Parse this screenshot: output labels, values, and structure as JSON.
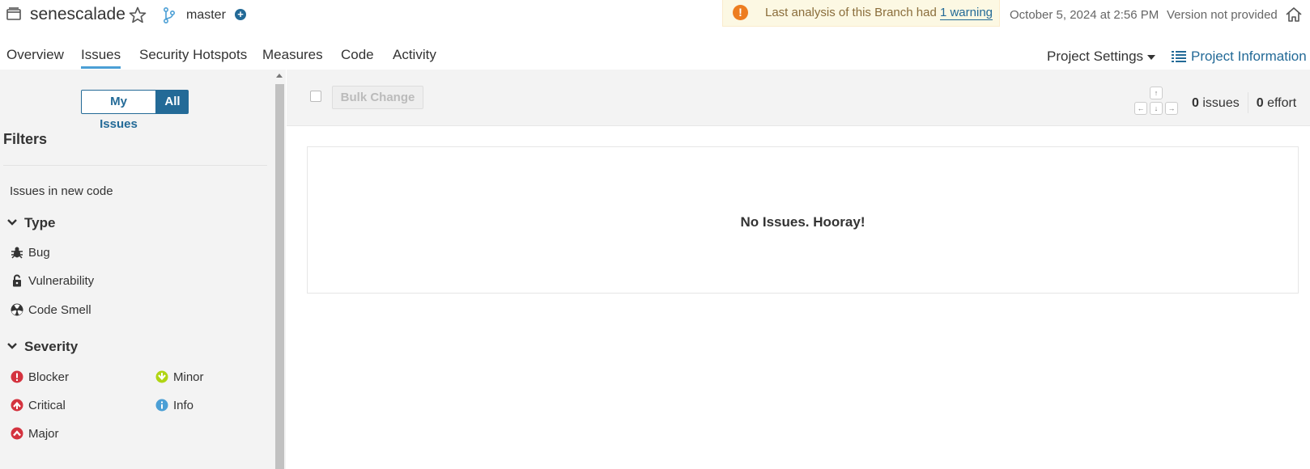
{
  "header": {
    "project_name": "senescalade",
    "branch": "master",
    "warning_text": "Last analysis of this Branch had",
    "warning_link": "1 warning",
    "analysis_date": "October 5, 2024 at 2:56 PM",
    "version": "Version not provided"
  },
  "nav": {
    "tabs": [
      "Overview",
      "Issues",
      "Security Hotspots",
      "Measures",
      "Code",
      "Activity"
    ],
    "active_tab": "Issues",
    "project_settings": "Project Settings",
    "project_information": "Project Information"
  },
  "sidebar": {
    "my_issues": "My Issues",
    "all": "All",
    "filters_title": "Filters",
    "new_code": "Issues in new code",
    "type_title": "Type",
    "types": [
      "Bug",
      "Vulnerability",
      "Code Smell"
    ],
    "severity_title": "Severity",
    "severities": [
      "Blocker",
      "Minor",
      "Critical",
      "Info",
      "Major"
    ]
  },
  "toolbar": {
    "bulk_change": "Bulk Change",
    "keys": {
      "up": "↑",
      "left": "←",
      "down": "↓",
      "right": "→"
    },
    "issues_count": "0",
    "issues_label": "issues",
    "effort_count": "0",
    "effort_label": "effort"
  },
  "main": {
    "empty_message": "No Issues. Hooray!"
  },
  "colors": {
    "brand_blue": "#236a97",
    "warning_bg": "#fcf8e3",
    "warning_orange": "#ed7d20",
    "severity_red": "#d4333f",
    "minor_green": "#b0d513",
    "info_blue": "#4b9fd5"
  }
}
